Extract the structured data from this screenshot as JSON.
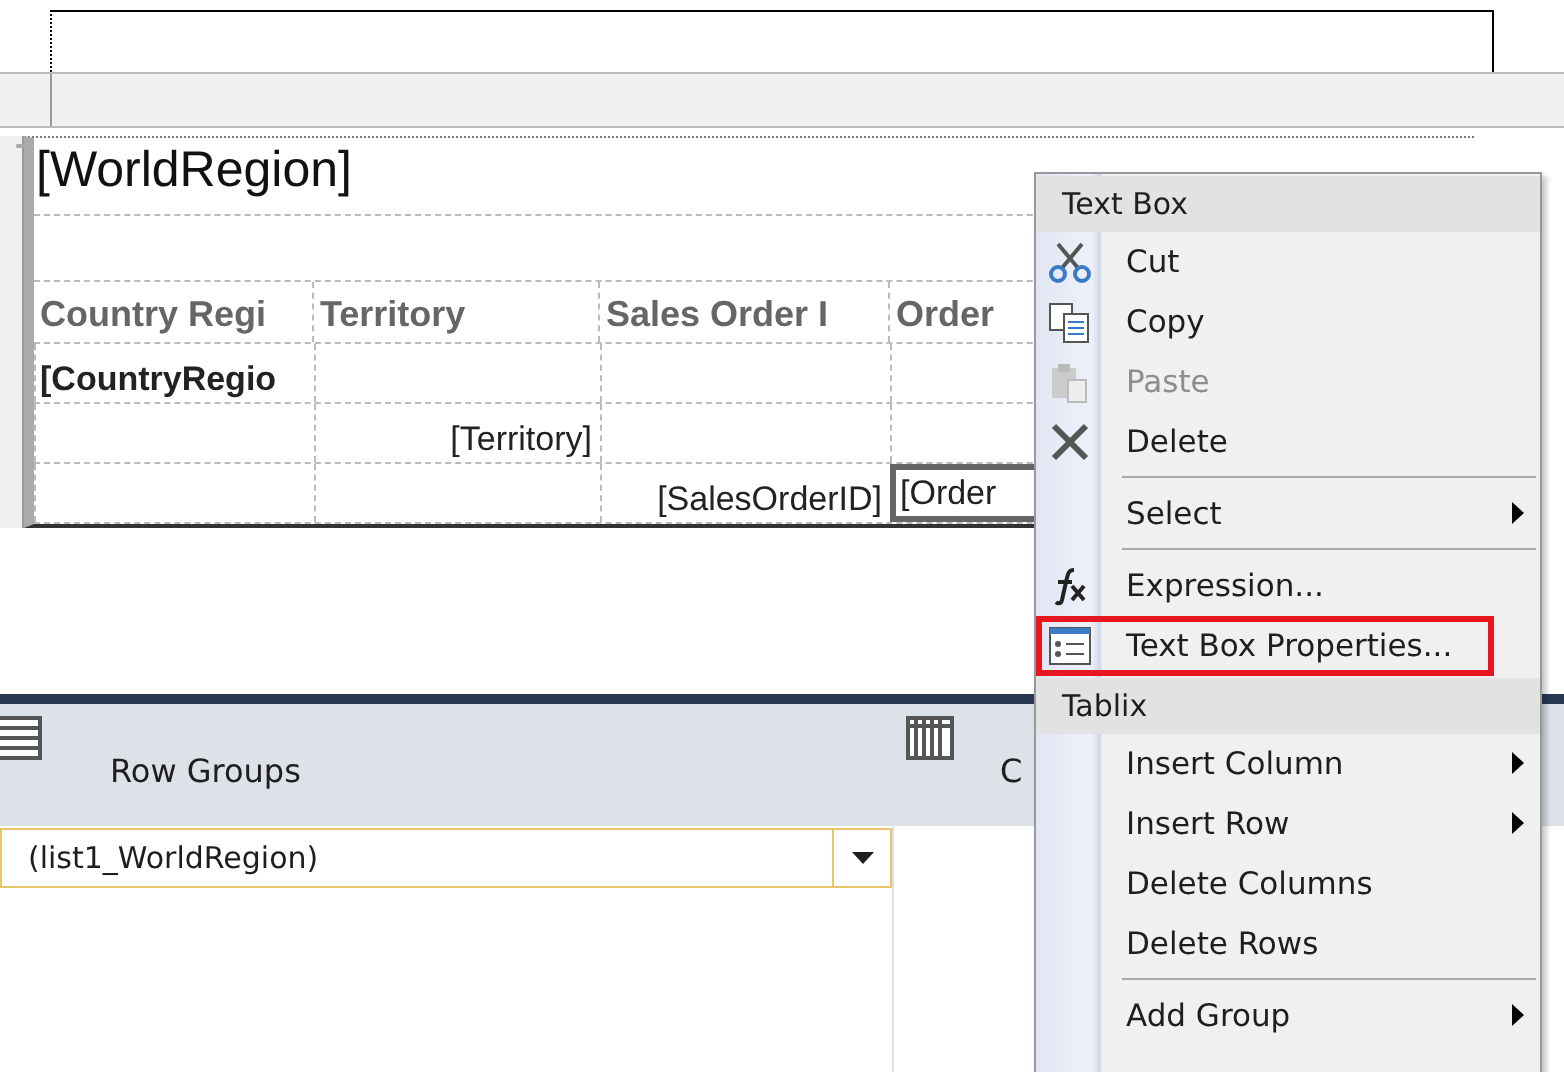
{
  "report": {
    "title_row": "[WorldRegion]",
    "columns": [
      "Country Regi",
      "Territory",
      "Sales Order I",
      "Order"
    ],
    "rows": [
      {
        "cells": [
          {
            "text": "[CountryRegio",
            "bold": true,
            "selected": false
          },
          {
            "selected": false
          },
          {
            "selected": false
          },
          {
            "selected": false
          }
        ]
      },
      {
        "cells": [
          {
            "selected": false
          },
          {
            "text": "[Territory]",
            "right_aligned": true,
            "selected": false
          },
          {
            "selected": false
          },
          {
            "selected": false
          }
        ]
      },
      {
        "cells": [
          {
            "selected": false
          },
          {
            "selected": false
          },
          {
            "text": "[SalesOrderID]",
            "right_aligned": true,
            "selected": false
          },
          {
            "text": "[Order",
            "selected": true
          }
        ]
      }
    ]
  },
  "grouping": {
    "row_groups": {
      "label": "Row Groups",
      "items": [
        {
          "label": "(list1_WorldRegion)",
          "selected": true
        }
      ]
    },
    "column_groups": {
      "label": "C"
    }
  },
  "context_menu": {
    "sections": [
      {
        "header": "Text Box",
        "items": [
          {
            "label": "Cut",
            "disabled": false,
            "submenu": false,
            "separator": false,
            "highlighted": false
          },
          {
            "label": "Copy",
            "disabled": false,
            "submenu": false,
            "separator": false,
            "highlighted": false
          },
          {
            "label": "Paste",
            "disabled": true,
            "submenu": false,
            "separator": false,
            "highlighted": false
          },
          {
            "label": "Delete",
            "disabled": false,
            "submenu": false,
            "separator": false,
            "highlighted": false
          },
          {
            "label": "Select",
            "disabled": false,
            "submenu": true,
            "separator": true,
            "highlighted": false
          },
          {
            "label": "Expression...",
            "disabled": false,
            "submenu": false,
            "separator": true,
            "highlighted": false
          },
          {
            "label": "Text Box Properties...",
            "disabled": false,
            "submenu": false,
            "separator": false,
            "highlighted": true
          }
        ]
      },
      {
        "header": "Tablix",
        "items": [
          {
            "label": "Insert Column",
            "disabled": false,
            "submenu": true,
            "separator": false,
            "highlighted": false
          },
          {
            "label": "Insert Row",
            "disabled": false,
            "submenu": true,
            "separator": false,
            "highlighted": false
          },
          {
            "label": "Delete Columns",
            "disabled": false,
            "submenu": false,
            "separator": false,
            "highlighted": false
          },
          {
            "label": "Delete Rows",
            "disabled": false,
            "submenu": false,
            "separator": false,
            "highlighted": false
          },
          {
            "label": "Add Group",
            "disabled": false,
            "submenu": true,
            "separator": true,
            "highlighted": false
          }
        ]
      }
    ]
  }
}
